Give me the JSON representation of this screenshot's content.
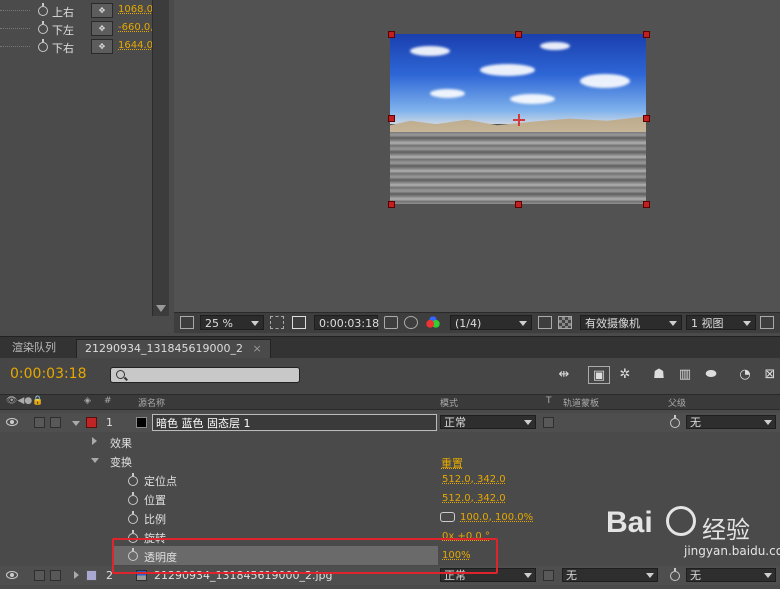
{
  "effect_controls": {
    "rows": [
      {
        "label": "上右",
        "value": "1068.0"
      },
      {
        "label": "下左",
        "value": "-660.0,"
      },
      {
        "label": "下右",
        "value": "1644.0,"
      }
    ]
  },
  "viewer_toolbar": {
    "zoom": "25 %",
    "timecode": "0:00:03:18",
    "resolution": "(1/4)",
    "camera": "有效摄像机",
    "views": "1 视图"
  },
  "tabs": [
    {
      "label": "渲染队列"
    },
    {
      "label": "21290934_131845619000_2"
    }
  ],
  "timeline": {
    "timecode": "0:00:03:18",
    "search_placeholder": "",
    "columns": {
      "name": "源名称",
      "mode": "模式",
      "t": "T",
      "trkmat": "轨道蒙板",
      "parent": "父级",
      "num": "#"
    },
    "layer1": {
      "num": "1",
      "name": "暗色 蓝色 固态层 1",
      "mode": "正常",
      "parent": "无",
      "color": "#c02424"
    },
    "effects_label": "效果",
    "transform_label": "变换",
    "reset_label": "重置",
    "properties": [
      {
        "name": "定位点",
        "value": "512.0, 342.0"
      },
      {
        "name": "位置",
        "value": "512.0, 342.0"
      },
      {
        "name": "比例",
        "value": "100.0, 100.0%"
      },
      {
        "name": "旋转",
        "value": "0x +0.0 °"
      },
      {
        "name": "透明度",
        "value": "100%"
      }
    ],
    "layer2": {
      "num": "2",
      "name": "21290934_131845619000_2.jpg",
      "mode": "正常",
      "trkmat": "无",
      "parent": "无",
      "color": "#a8a8d0"
    }
  },
  "watermark": {
    "brand": "Bai",
    "brand2": "经验",
    "url": "jingyan.baidu.com"
  },
  "colors": {
    "accent": "#e6a800",
    "highlight": "#e0242b"
  }
}
